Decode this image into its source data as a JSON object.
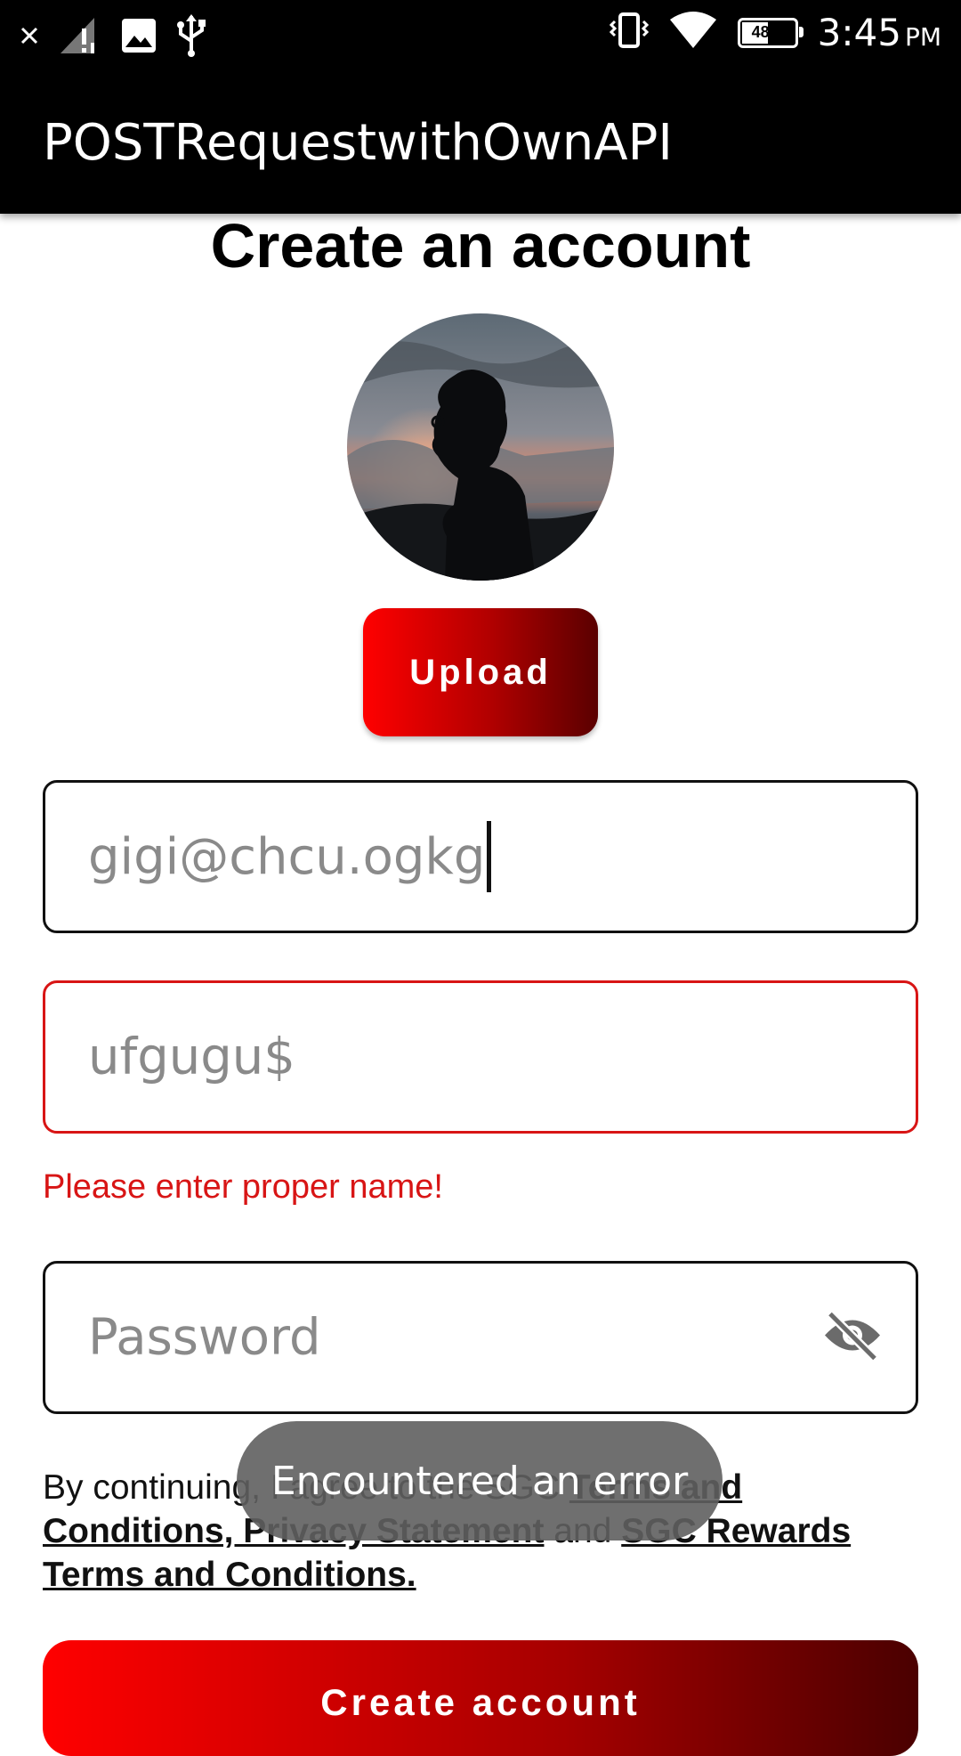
{
  "status_bar": {
    "time": "3:45",
    "ampm": "PM",
    "battery_percent": "48%",
    "battery_level": 0.48,
    "icons": [
      "close-icon",
      "signal-icon",
      "image-icon",
      "usb-icon",
      "vibrate-icon",
      "wifi-icon",
      "battery-icon"
    ]
  },
  "app_bar": {
    "title": "POSTRequestwithOwnAPI"
  },
  "page": {
    "title": "Create an account"
  },
  "upload": {
    "label": "Upload"
  },
  "email": {
    "value": "gigi@chcu.ogkg"
  },
  "name": {
    "value": "ufgugu$",
    "error": "Please enter proper name!"
  },
  "password": {
    "placeholder": "Password"
  },
  "terms": {
    "prefix": "By continuing, I agree to the SGC ",
    "link1": "Terms and Conditions, Privacy Statement",
    "middle": " and ",
    "link2": "SGC Rewards Terms and Conditions."
  },
  "toast": {
    "message": "Encountered an error"
  },
  "create_button": {
    "label": "Create account"
  },
  "colors": {
    "accent": "#ff0000",
    "accent_dark": "#4a0000",
    "error": "#d81515"
  }
}
